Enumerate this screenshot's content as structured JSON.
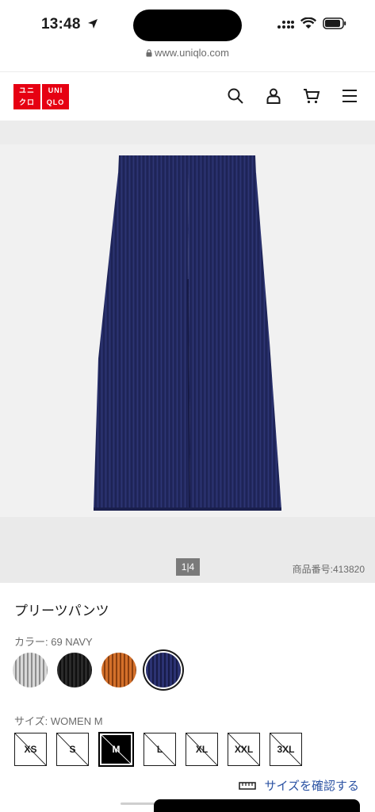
{
  "status_bar": {
    "time": "13:48"
  },
  "browser": {
    "url": "www.uniqlo.com"
  },
  "header": {
    "logo_top": "ユニ",
    "logo_bottom": "クロ",
    "logo_top_en": "UNI",
    "logo_bottom_en": "QLO",
    "icons": [
      "search-icon",
      "account-icon",
      "cart-icon",
      "menu-icon"
    ]
  },
  "gallery": {
    "page_indicator": "1|4",
    "product_code": "商品番号:413820"
  },
  "product": {
    "name": "プリーツパンツ",
    "color_label": "カラー: 69 NAVY",
    "colors": [
      {
        "name": "gray-stripe",
        "hex": "#b9b9b9"
      },
      {
        "name": "black",
        "hex": "#1c1c1c"
      },
      {
        "name": "orange",
        "hex": "#c8641c"
      },
      {
        "name": "navy",
        "hex": "#232a63"
      }
    ],
    "size_label": "サイズ: WOMEN M",
    "sizes": [
      "XS",
      "S",
      "M",
      "L",
      "XL",
      "XXL",
      "3XL"
    ],
    "selected_size": "M",
    "size_guide": "サイズを確認する"
  },
  "colors": {
    "brand_red": "#e60012",
    "link_blue": "#2c53a3",
    "navy": "#242b63"
  }
}
